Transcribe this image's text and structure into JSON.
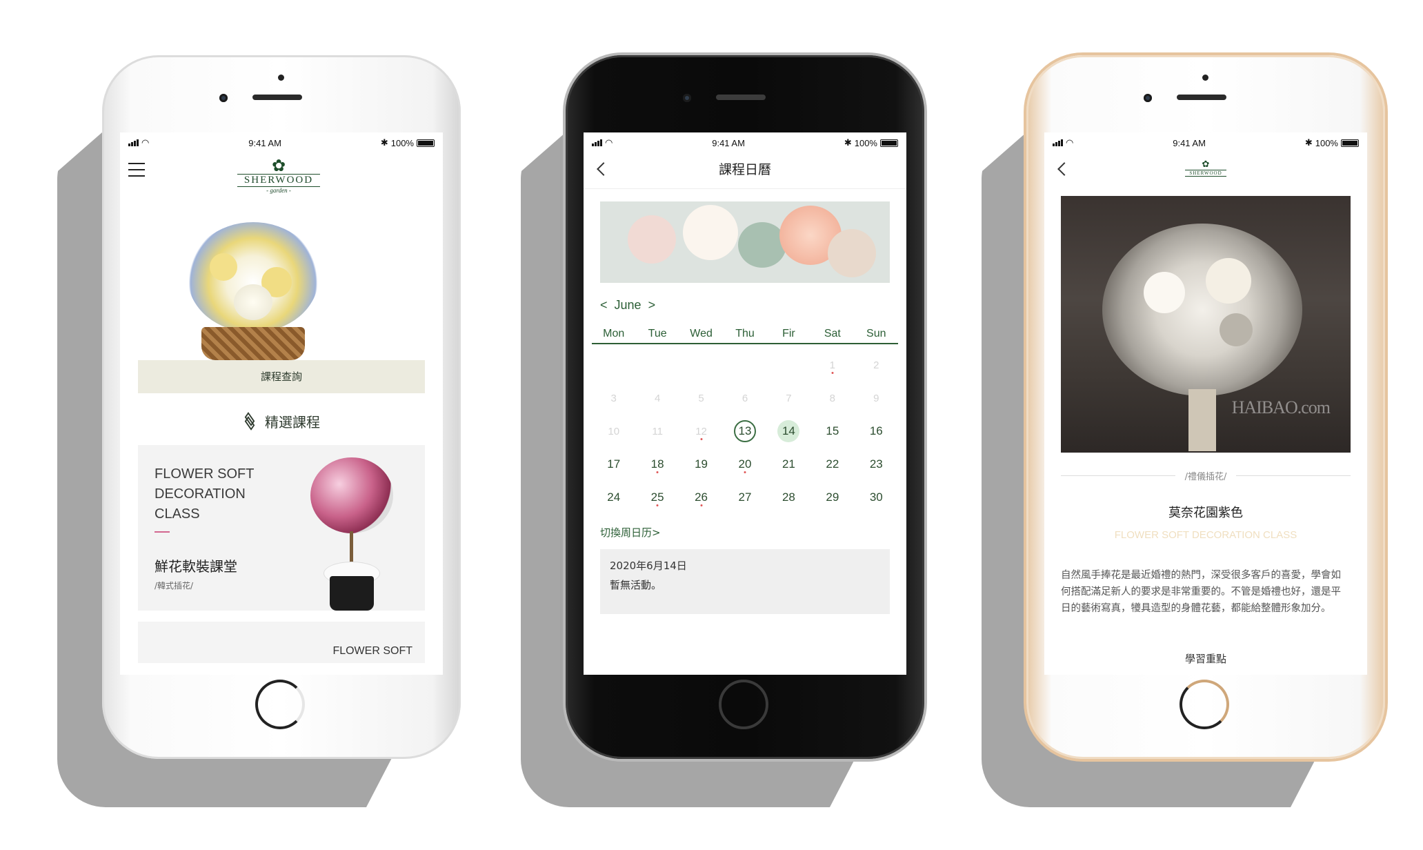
{
  "status_bar": {
    "time": "9:41 AM",
    "battery": "100%"
  },
  "screen1": {
    "logo": {
      "name": "SHERWOOD",
      "sub": "- garden -"
    },
    "query_button": "課程查詢",
    "section_title": "精選課程",
    "card": {
      "title_en_line1": "FLOWER SOFT",
      "title_en_line2": "DECORATION",
      "title_en_line3": "CLASS",
      "title_zh": "鮮花軟裝課堂",
      "tag": "/韓式插花/"
    },
    "card2": {
      "title_en": "FLOWER SOFT"
    }
  },
  "screen2": {
    "title": "課程日曆",
    "month_label": "June",
    "prev_label": "<",
    "next_label": ">",
    "weekdays": [
      "Mon",
      "Tue",
      "Wed",
      "Thu",
      "Fir",
      "Sat",
      "Sun"
    ],
    "switch_link": "切換周日历>",
    "event_date": "2020年6月14日",
    "event_text": "暫無活動。"
  },
  "screen3": {
    "watermark": "HAIBAO.com",
    "category": "/禮儀插花/",
    "title": "莫奈花園紫色",
    "subtitle_en": "FLOWER SOFT DECORATION CLASS",
    "description": "自然風手捧花是最近婚禮的熱門，深受很多客戶的喜愛，學會如何搭配滿足新人的要求是非常重要的。不管是婚禮也好，還是平日的藝術寫真，犪具造型的身體花藝，都能給整體形象加分。",
    "section_heading": "學習重點"
  },
  "colors": {
    "brand_green": "#2b5e35",
    "query_bg": "#ecebdf",
    "accent_pink": "#d2668f",
    "selected_bg": "#d7ecd9"
  }
}
